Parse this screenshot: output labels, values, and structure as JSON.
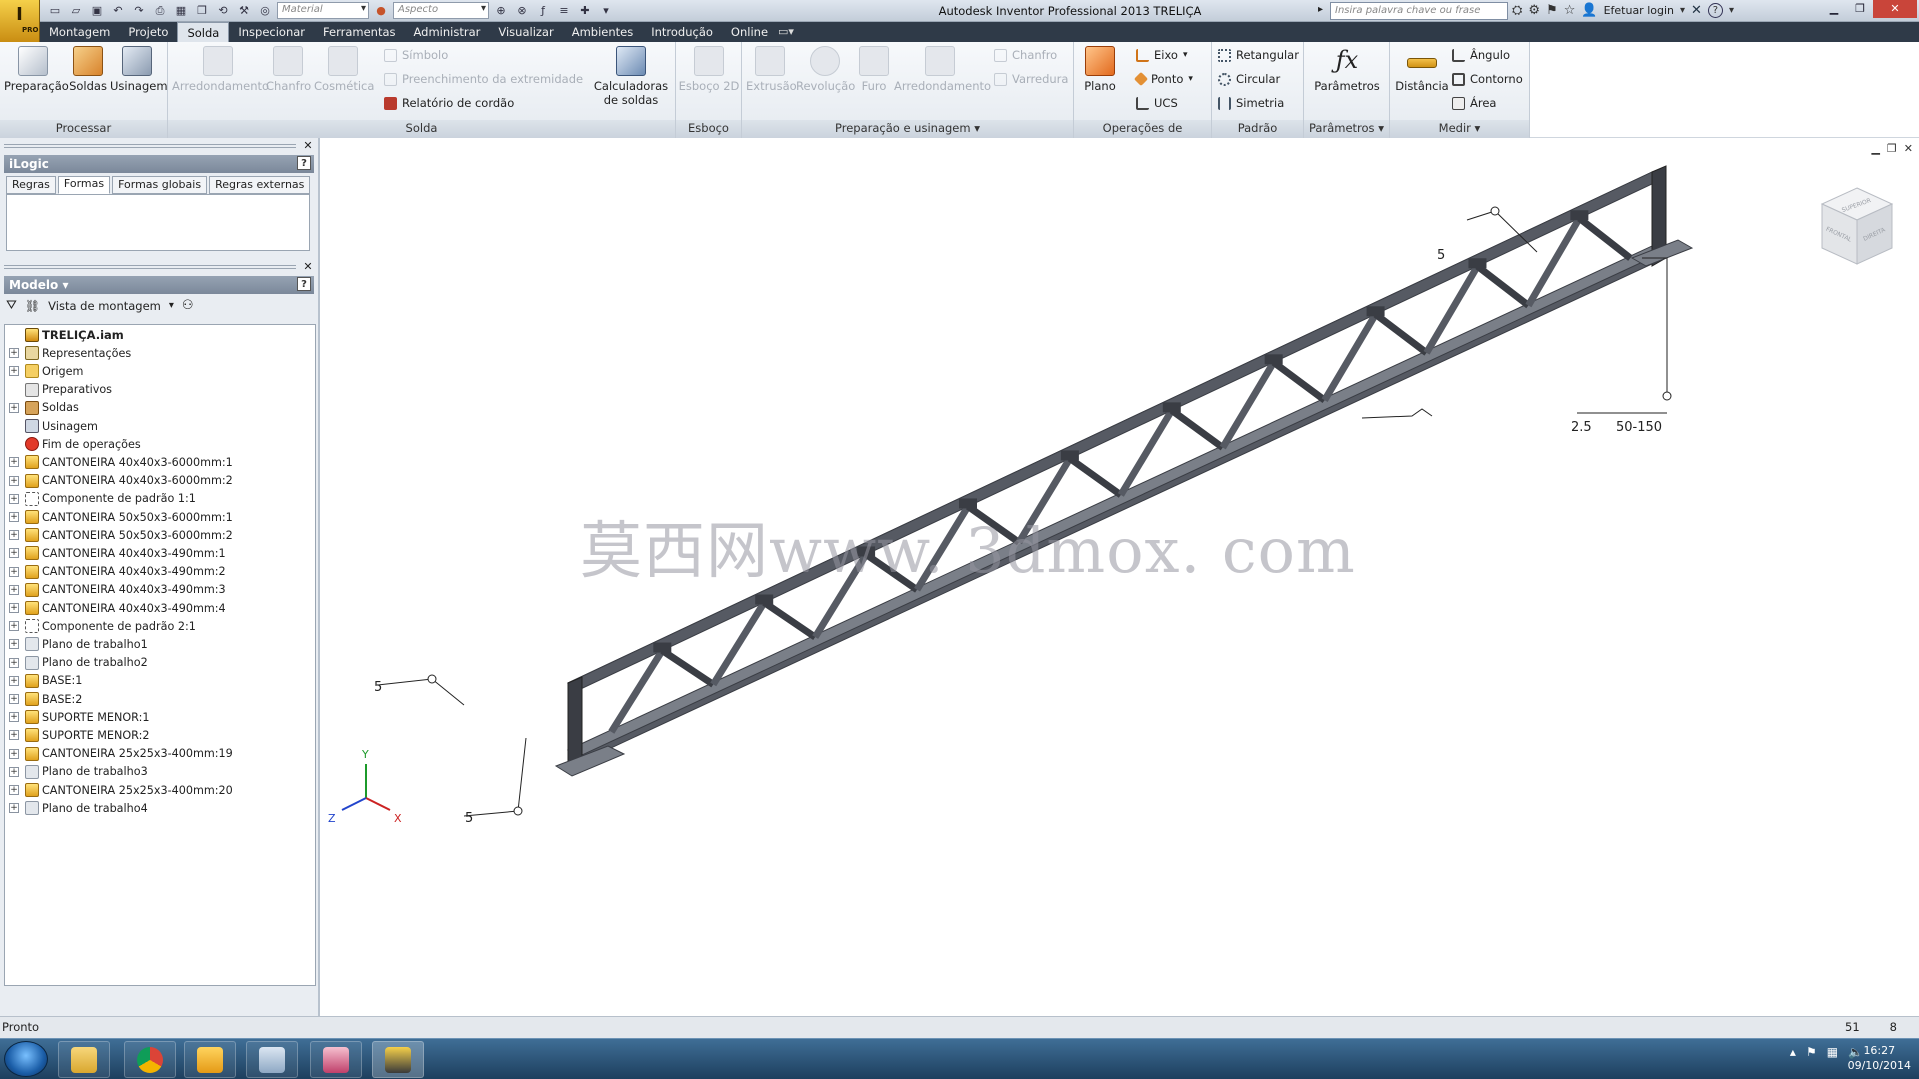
{
  "titlebar": {
    "logo_text": "PRO",
    "material_placeholder": "Material",
    "aspect_placeholder": "Aspecto",
    "title": "Autodesk Inventor Professional 2013    TRELIÇA",
    "search_placeholder": "Insira palavra chave ou frase",
    "login": "Efetuar login",
    "help": "?"
  },
  "menu": [
    "Montagem",
    "Projeto",
    "Solda",
    "Inspecionar",
    "Ferramentas",
    "Administrar",
    "Visualizar",
    "Ambientes",
    "Introdução",
    "Online"
  ],
  "menu_active": "Solda",
  "ribbon": {
    "panels": {
      "processar": "Processar",
      "solda": "Solda",
      "esboco": "Esboço",
      "preparacao": "Preparação e usinagem ▾",
      "operacoes": "Operações de referência",
      "padrao": "Padrão",
      "parametros": "Parâmetros ▾",
      "medir": "Medir ▾"
    },
    "buttons": {
      "preparacao": "Preparação",
      "soldas": "Soldas",
      "usinagem": "Usinagem",
      "arredondamento": "Arredondamento",
      "chanfro": "Chanfro",
      "cosmetica": "Cosmética",
      "simbolo": "Símbolo",
      "preenchimento": "Preenchimento da extremidade",
      "relatorio": "Relatório de cordão",
      "calculadoras_1": "Calculadoras",
      "calculadoras_2": "de soldas",
      "esboco2d": "Esboço 2D",
      "extrusao": "Extrusão",
      "revolucao": "Revolução",
      "furo": "Furo",
      "arredondamento2": "Arredondamento",
      "chanfro2": "Chanfro",
      "varredura": "Varredura",
      "plano": "Plano",
      "eixo": "Eixo",
      "ponto": "Ponto",
      "ucs": "UCS",
      "retangular": "Retangular",
      "circular": "Circular",
      "simetria": "Simetria",
      "parametros": "Parâmetros",
      "distancia": "Distância",
      "angulo": "Ângulo",
      "contorno": "Contorno",
      "area": "Área"
    }
  },
  "ilogic": {
    "title": "iLogic",
    "tabs": [
      "Regras",
      "Formas",
      "Formas globais",
      "Regras externas"
    ],
    "active_tab": "Formas"
  },
  "modelo": {
    "title": "Modelo ▾",
    "view": "Vista de montagem",
    "tree": [
      {
        "label": "TRELIÇA.iam",
        "icon": "root",
        "exp": false
      },
      {
        "label": "Representações",
        "icon": "rep",
        "exp": true
      },
      {
        "label": "Origem",
        "icon": "folder",
        "exp": true
      },
      {
        "label": "Preparativos",
        "icon": "prep",
        "exp": false
      },
      {
        "label": "Soldas",
        "icon": "weld",
        "exp": true
      },
      {
        "label": "Usinagem",
        "icon": "mach",
        "exp": false
      },
      {
        "label": "Fim de operações",
        "icon": "end",
        "exp": false
      },
      {
        "label": "CANTONEIRA 40x40x3-6000mm:1",
        "icon": "part",
        "exp": true
      },
      {
        "label": "CANTONEIRA 40x40x3-6000mm:2",
        "icon": "part",
        "exp": true
      },
      {
        "label": "Componente de padrão 1:1",
        "icon": "pattern",
        "exp": true
      },
      {
        "label": "CANTONEIRA 50x50x3-6000mm:1",
        "icon": "part",
        "exp": true
      },
      {
        "label": "CANTONEIRA 50x50x3-6000mm:2",
        "icon": "part",
        "exp": true
      },
      {
        "label": "CANTONEIRA 40x40x3-490mm:1",
        "icon": "part",
        "exp": true
      },
      {
        "label": "CANTONEIRA 40x40x3-490mm:2",
        "icon": "part",
        "exp": true
      },
      {
        "label": "CANTONEIRA 40x40x3-490mm:3",
        "icon": "part",
        "exp": true
      },
      {
        "label": "CANTONEIRA 40x40x3-490mm:4",
        "icon": "part",
        "exp": true
      },
      {
        "label": "Componente de padrão 2:1",
        "icon": "pattern",
        "exp": true
      },
      {
        "label": "Plano de trabalho1",
        "icon": "plane",
        "exp": true
      },
      {
        "label": "Plano de trabalho2",
        "icon": "plane",
        "exp": true
      },
      {
        "label": "BASE:1",
        "icon": "part",
        "exp": true
      },
      {
        "label": "BASE:2",
        "icon": "part",
        "exp": true
      },
      {
        "label": "SUPORTE MENOR:1",
        "icon": "part",
        "exp": true
      },
      {
        "label": "SUPORTE MENOR:2",
        "icon": "part",
        "exp": true
      },
      {
        "label": "CANTONEIRA 25x25x3-400mm:19",
        "icon": "part",
        "exp": true
      },
      {
        "label": "Plano de trabalho3",
        "icon": "plane",
        "exp": true
      },
      {
        "label": "CANTONEIRA 25x25x3-400mm:20",
        "icon": "part",
        "exp": true
      },
      {
        "label": "Plano de trabalho4",
        "icon": "plane",
        "exp": true
      }
    ]
  },
  "viewport": {
    "viewcube_top": "SUPERIOR",
    "viewcube_front": "FRONTAL",
    "viewcube_right": "DIREITA",
    "watermark": "莫西网www. 3dmox. com",
    "weld_labels": {
      "top_left": "5",
      "top_right_a": "2.5",
      "top_right_b": "50-150",
      "left": "5",
      "bottom": "5"
    },
    "axis": {
      "x": "X",
      "y": "Y",
      "z": "Z"
    }
  },
  "status": {
    "text": "Pronto",
    "num1": "51",
    "num2": "8"
  },
  "taskbar": {
    "time": "16:27",
    "date": "09/10/2014"
  },
  "colors": {
    "steel": "#565a63",
    "steel_light": "#7a7f88",
    "steel_dark": "#3a3d44"
  }
}
